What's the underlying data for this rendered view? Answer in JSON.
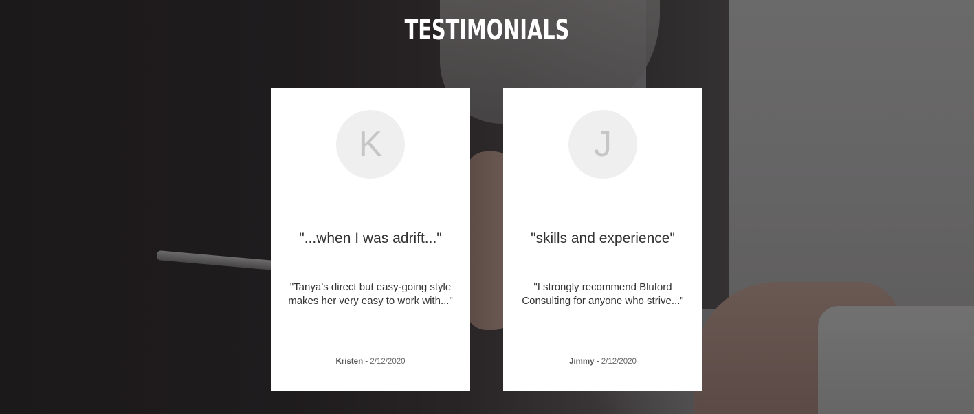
{
  "section": {
    "title": "TESTIMONIALS"
  },
  "testimonials": [
    {
      "initial": "K",
      "headline": "\"...when I was adrift...\"",
      "quote": "\"Tanya’s direct but easy-going style makes her very easy to work with...\"",
      "author": "Kristen",
      "separator": " - ",
      "date": "2/12/2020"
    },
    {
      "initial": "J",
      "headline": "\"skills and experience\"",
      "quote": "\"I strongly recommend Bluford Consulting for anyone who strive...\"",
      "author": "Jimmy",
      "separator": " - ",
      "date": "2/12/2020"
    }
  ],
  "colors": {
    "card_background": "#ffffff",
    "avatar_background": "#efefef",
    "avatar_initial": "#c6c6c6",
    "title_text": "#ffffff",
    "body_text": "#333333"
  }
}
